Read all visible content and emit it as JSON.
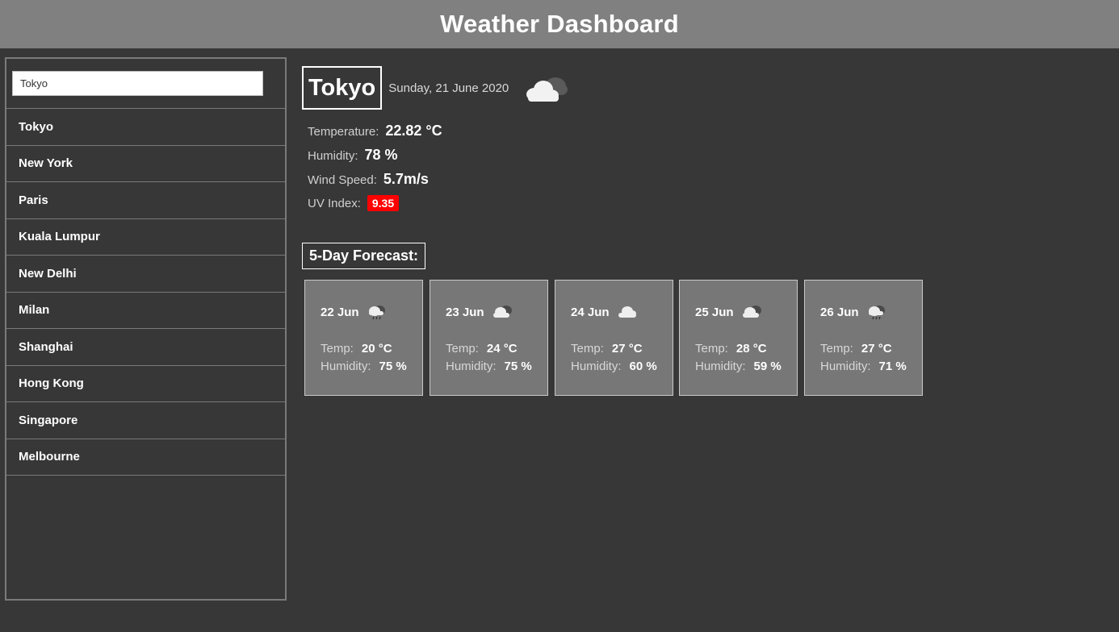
{
  "header": {
    "title": "Weather Dashboard"
  },
  "search": {
    "value": "Tokyo"
  },
  "cities": [
    "Tokyo",
    "New York",
    "Paris",
    "Kuala Lumpur",
    "New Delhi",
    "Milan",
    "Shanghai",
    "Hong Kong",
    "Singapore",
    "Melbourne"
  ],
  "current": {
    "city": "Tokyo",
    "date": "Sunday, 21 June 2020",
    "icon": "cloud-icon",
    "temperature_label": "Temperature:",
    "temperature": "22.82 °C",
    "humidity_label": "Humidity:",
    "humidity": "78 %",
    "wind_label": "Wind Speed:",
    "wind": "5.7m/s",
    "uv_label": "UV Index:",
    "uv": "9.35",
    "uv_color": "#ff0000"
  },
  "forecast": {
    "title": "5-Day Forecast:",
    "temp_label": "Temp:",
    "humidity_label": "Humidity:",
    "days": [
      {
        "date": "22 Jun",
        "icon": "rain-cloud-icon",
        "temp": "20 °C",
        "humidity": "75 %"
      },
      {
        "date": "23 Jun",
        "icon": "cloud-icon",
        "temp": "24 °C",
        "humidity": "75 %"
      },
      {
        "date": "24 Jun",
        "icon": "cloud-icon",
        "temp": "27 °C",
        "humidity": "60 %"
      },
      {
        "date": "25 Jun",
        "icon": "cloud-icon",
        "temp": "28 °C",
        "humidity": "59 %"
      },
      {
        "date": "26 Jun",
        "icon": "rain-cloud-icon",
        "temp": "27 °C",
        "humidity": "71 %"
      }
    ]
  }
}
